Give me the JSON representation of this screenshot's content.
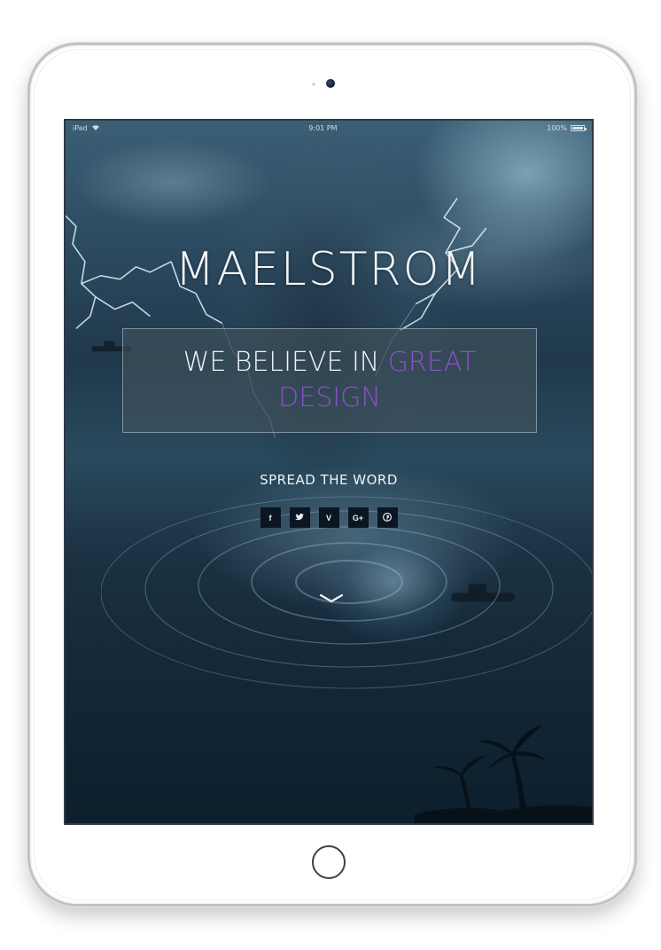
{
  "status_bar": {
    "device": "iPad",
    "time": "9:01 PM",
    "battery": "100%"
  },
  "hero": {
    "brand": "MAELSTROM",
    "tagline_prefix": "WE BELIEVE IN ",
    "tagline_accent": "GREAT DESIGN",
    "spread_label": "SPREAD THE WORD",
    "accent_color": "#8b4fc9"
  },
  "social": {
    "icons": [
      "facebook-icon",
      "twitter-icon",
      "vimeo-icon",
      "google-plus-icon",
      "pinterest-icon"
    ],
    "facebook": "f",
    "vimeo": "V",
    "google_plus": "G+"
  },
  "scroll_icon": "chevron-down-icon"
}
